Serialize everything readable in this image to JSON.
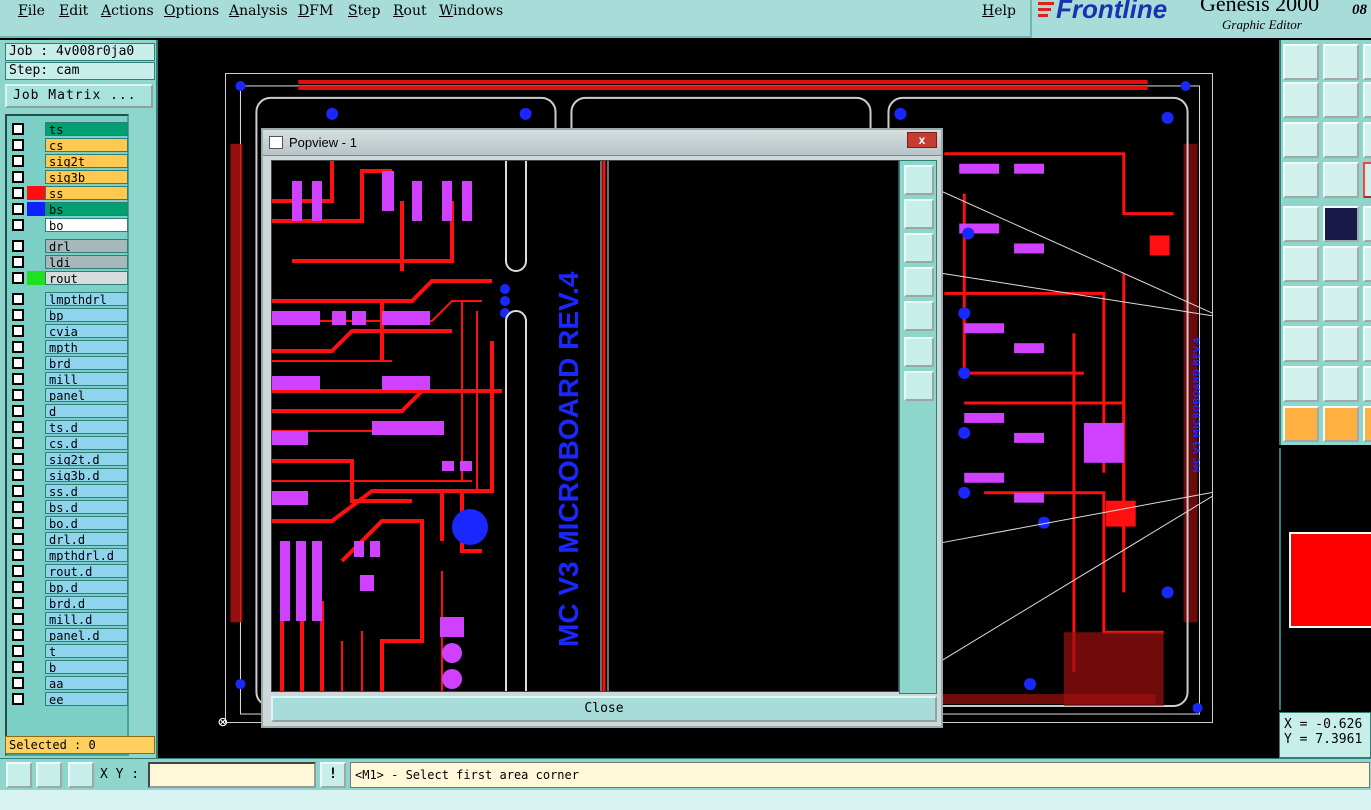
{
  "menu": {
    "items": [
      "File",
      "Edit",
      "Actions",
      "Options",
      "Analysis",
      "DFM",
      "Step",
      "Rout",
      "Windows"
    ],
    "help": "Help"
  },
  "brand": {
    "name": "Frontline",
    "product": "Genesis 2000",
    "subtitle": "Graphic Editor",
    "cut_text": "08"
  },
  "job": {
    "job_line": "Job : 4v008r0ja0",
    "step_line": "Step: cam",
    "matrix_button": "Job Matrix ..."
  },
  "layers": [
    {
      "name": "ts",
      "bg": "#00a070",
      "fg": "#000",
      "swatch": ""
    },
    {
      "name": "cs",
      "bg": "#ffc850",
      "fg": "#000",
      "swatch": ""
    },
    {
      "name": "sig2t",
      "bg": "#ffc850",
      "fg": "#000",
      "swatch": ""
    },
    {
      "name": "sig3b",
      "bg": "#ffc850",
      "fg": "#000",
      "swatch": ""
    },
    {
      "name": "ss",
      "bg": "#ffc850",
      "fg": "#000",
      "swatch": "#ff1010"
    },
    {
      "name": "bs",
      "bg": "#00a070",
      "fg": "#000",
      "swatch": "#1020ff"
    },
    {
      "name": "bo",
      "bg": "#ffffff",
      "fg": "#000",
      "swatch": ""
    },
    {
      "name": "drl",
      "bg": "#a6b8bc",
      "fg": "#000",
      "swatch": ""
    },
    {
      "name": "ldi",
      "bg": "#a6b8bc",
      "fg": "#000",
      "swatch": ""
    },
    {
      "name": "rout",
      "bg": "#d8dcdc",
      "fg": "#000",
      "swatch": "#20e020"
    },
    {
      "name": "lmpthdrl",
      "bg": "#8fd4ec",
      "fg": "#000",
      "swatch": ""
    },
    {
      "name": "bp",
      "bg": "#8fd4ec",
      "fg": "#000",
      "swatch": ""
    },
    {
      "name": "cvia",
      "bg": "#8fd4ec",
      "fg": "#000",
      "swatch": ""
    },
    {
      "name": "mpth",
      "bg": "#8fd4ec",
      "fg": "#000",
      "swatch": ""
    },
    {
      "name": "brd",
      "bg": "#8fd4ec",
      "fg": "#000",
      "swatch": ""
    },
    {
      "name": "mill",
      "bg": "#8fd4ec",
      "fg": "#000",
      "swatch": ""
    },
    {
      "name": "panel",
      "bg": "#8fd4ec",
      "fg": "#000",
      "swatch": ""
    },
    {
      "name": "d",
      "bg": "#8fd4ec",
      "fg": "#000",
      "swatch": ""
    },
    {
      "name": "ts.d",
      "bg": "#8fd4ec",
      "fg": "#000",
      "swatch": ""
    },
    {
      "name": "cs.d",
      "bg": "#8fd4ec",
      "fg": "#000",
      "swatch": ""
    },
    {
      "name": "sig2t.d",
      "bg": "#8fd4ec",
      "fg": "#000",
      "swatch": ""
    },
    {
      "name": "sig3b.d",
      "bg": "#8fd4ec",
      "fg": "#000",
      "swatch": ""
    },
    {
      "name": "ss.d",
      "bg": "#8fd4ec",
      "fg": "#000",
      "swatch": ""
    },
    {
      "name": "bs.d",
      "bg": "#8fd4ec",
      "fg": "#000",
      "swatch": ""
    },
    {
      "name": "bo.d",
      "bg": "#8fd4ec",
      "fg": "#000",
      "swatch": ""
    },
    {
      "name": "drl.d",
      "bg": "#8fd4ec",
      "fg": "#000",
      "swatch": ""
    },
    {
      "name": "mpthdrl.d",
      "bg": "#8fd4ec",
      "fg": "#000",
      "swatch": ""
    },
    {
      "name": "rout.d",
      "bg": "#8fd4ec",
      "fg": "#000",
      "swatch": ""
    },
    {
      "name": "bp.d",
      "bg": "#8fd4ec",
      "fg": "#000",
      "swatch": ""
    },
    {
      "name": "brd.d",
      "bg": "#8fd4ec",
      "fg": "#000",
      "swatch": ""
    },
    {
      "name": "mill.d",
      "bg": "#8fd4ec",
      "fg": "#000",
      "swatch": ""
    },
    {
      "name": "panel.d",
      "bg": "#8fd4ec",
      "fg": "#000",
      "swatch": ""
    },
    {
      "name": "t",
      "bg": "#8fd4ec",
      "fg": "#000",
      "swatch": ""
    },
    {
      "name": "b",
      "bg": "#8fd4ec",
      "fg": "#000",
      "swatch": ""
    },
    {
      "name": "aa",
      "bg": "#8fd4ec",
      "fg": "#000",
      "swatch": ""
    },
    {
      "name": "ee",
      "bg": "#8fd4ec",
      "fg": "#000",
      "swatch": ""
    }
  ],
  "selected": "Selected : 0",
  "popview": {
    "title": "Popview - 1",
    "board_text": "MC V3 MICROBOARD REV.4",
    "close_label": "Close",
    "close_x": "x"
  },
  "board": {
    "side_text": "MC V3 MICROBOARD REV.4"
  },
  "coords": {
    "x": "X = -0.626",
    "y": "Y = 7.3961"
  },
  "bottom": {
    "xy_label": "X Y :",
    "xy_value": "",
    "warn_label": "!",
    "prompt": "<M1> - Select first area corner"
  },
  "colors": {
    "copper": "#ff1010",
    "pads": "#d040ff",
    "vias": "#1a28ff",
    "panel_bg": "#8ed6cc"
  }
}
